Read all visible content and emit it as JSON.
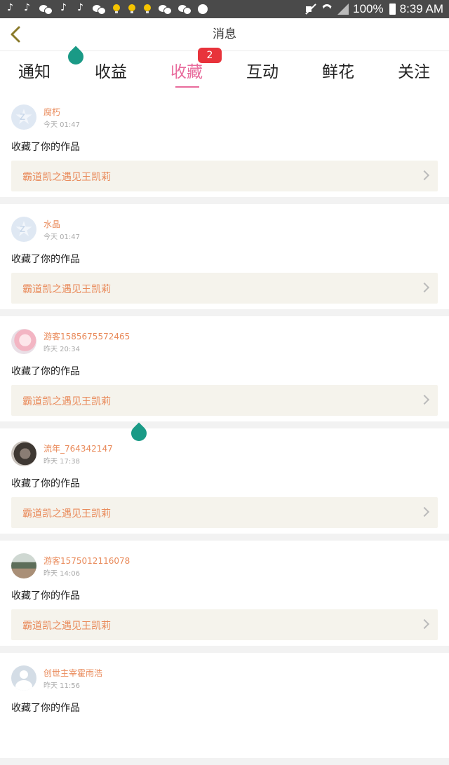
{
  "status_bar": {
    "battery": "100%",
    "time": "8:39 AM"
  },
  "header": {
    "title": "消息"
  },
  "tabs": [
    {
      "label": "通知"
    },
    {
      "label": "收益"
    },
    {
      "label": "收藏",
      "active": true,
      "badge": "2"
    },
    {
      "label": "互动"
    },
    {
      "label": "鲜花"
    },
    {
      "label": "关注"
    }
  ],
  "items": [
    {
      "name": "腐朽",
      "time": "今天 01:47",
      "action": "收藏了你的作品",
      "work": "霸道凯之遇见王凯莉",
      "avatar": "default-avatar"
    },
    {
      "name": "水晶",
      "time": "今天 01:47",
      "action": "收藏了你的作品",
      "work": "霸道凯之遇见王凯莉",
      "avatar": "default-avatar"
    },
    {
      "name": "游客1585675572465",
      "time": "昨天 20:34",
      "action": "收藏了你的作品",
      "work": "霸道凯之遇见王凯莉",
      "avatar": "anime-avatar"
    },
    {
      "name": "流年_764342147",
      "time": "昨天 17:38",
      "action": "收藏了你的作品",
      "work": "霸道凯之遇见王凯莉",
      "avatar": "photo-avatar"
    },
    {
      "name": "游客1575012116078",
      "time": "昨天 14:06",
      "action": "收藏了你的作品",
      "work": "霸道凯之遇见王凯莉",
      "avatar": "scene-avatar"
    },
    {
      "name": "创世主宰霍雨浩",
      "time": "昨天 11:56",
      "action": "收藏了你的作品",
      "work": "",
      "avatar": "person-avatar"
    }
  ],
  "colors": {
    "accent": "#e86b9c",
    "username": "#e98a5a",
    "badge": "#e8333b",
    "teal": "#1a9a86"
  }
}
